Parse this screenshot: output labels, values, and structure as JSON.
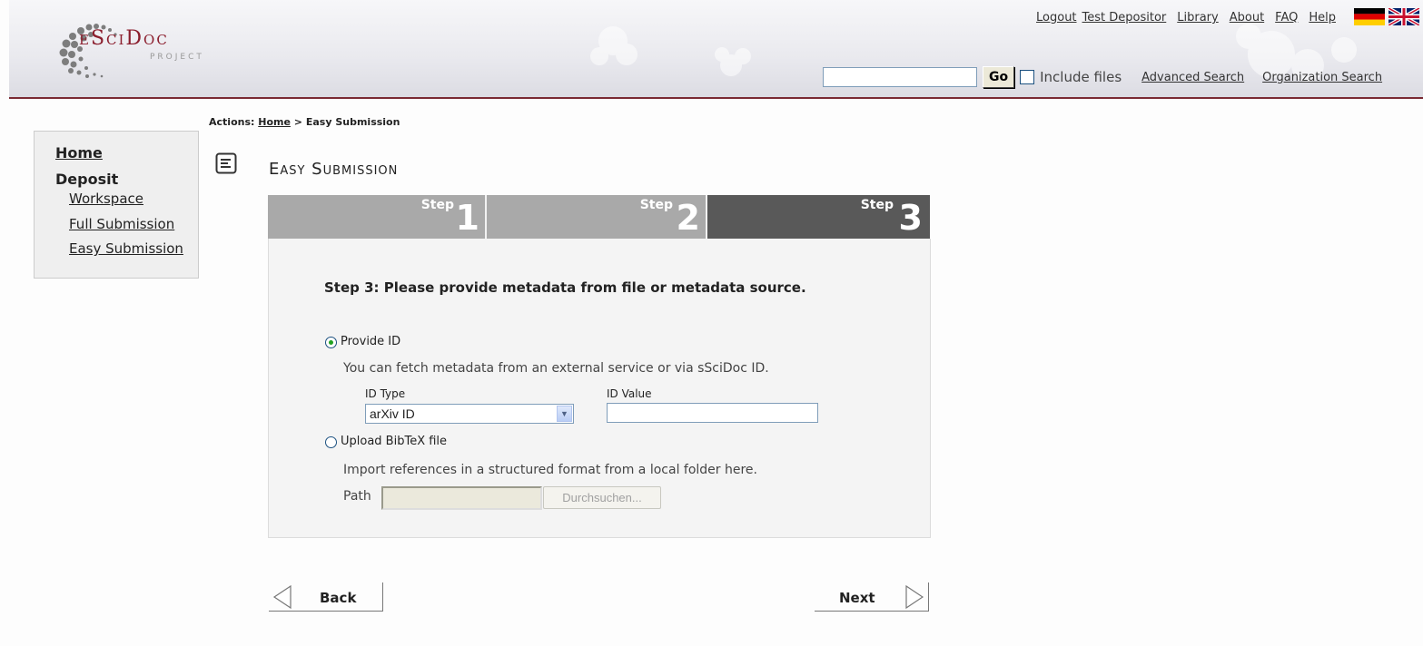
{
  "header": {
    "logo_text": "eSciDoc",
    "logo_sub": "PROJECT",
    "nav": [
      "Logout",
      "Library",
      "About",
      "FAQ",
      "Help"
    ],
    "user": "Test Depositor",
    "flags": [
      "german-flag-icon",
      "uk-flag-icon"
    ],
    "search": {
      "value": "",
      "go_label": "Go",
      "include_files_label": "Include files",
      "include_files_checked": false,
      "advanced_search": "Advanced Search",
      "organization_search": "Organization Search"
    }
  },
  "breadcrumb": {
    "prefix": "Actions:",
    "home": "Home",
    "separator": ">",
    "current": "Easy Submission"
  },
  "sidebar": {
    "home": "Home",
    "deposit": "Deposit",
    "items": [
      {
        "label": "Workspace"
      },
      {
        "label": "Full Submission"
      },
      {
        "label": "Easy Submission"
      }
    ]
  },
  "page": {
    "title": "Easy Submission"
  },
  "steps": [
    {
      "word": "Step",
      "number": "1",
      "active": false
    },
    {
      "word": "Step",
      "number": "2",
      "active": false
    },
    {
      "word": "Step",
      "number": "3",
      "active": true
    }
  ],
  "form": {
    "heading": "Step 3: Please provide metadata from file or metadata source.",
    "option_id": {
      "label": "Provide ID",
      "checked": true,
      "description": "You can fetch metadata from an external service or via sSciDoc ID.",
      "id_type_label": "ID Type",
      "id_type_value": "arXiv ID",
      "id_value_label": "ID Value",
      "id_value": ""
    },
    "option_bibtex": {
      "label": "Upload BibTeX file",
      "checked": false,
      "description": "Import references in a structured format from a local folder here.",
      "path_label": "Path",
      "path_value": "",
      "browse_label": "Durchsuchen..."
    }
  },
  "buttons": {
    "back": "Back",
    "next": "Next"
  },
  "colors": {
    "accent": "#8b1e2d",
    "step_inactive": "#a9a9a9",
    "step_active": "#595959",
    "panel_bg": "#f4f4f4"
  }
}
